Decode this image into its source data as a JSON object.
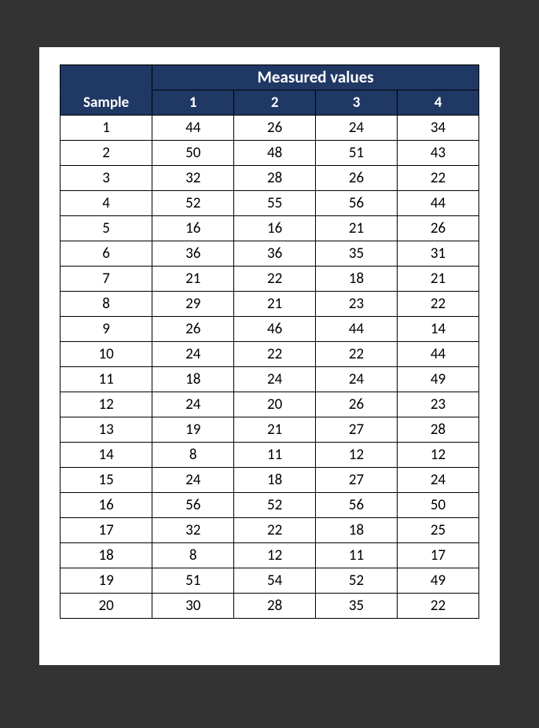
{
  "table": {
    "title": "Measured values",
    "sampleHeader": "Sample",
    "columns": [
      "1",
      "2",
      "3",
      "4"
    ],
    "rows": [
      {
        "sample": "1",
        "v": [
          "44",
          "26",
          "24",
          "34"
        ]
      },
      {
        "sample": "2",
        "v": [
          "50",
          "48",
          "51",
          "43"
        ]
      },
      {
        "sample": "3",
        "v": [
          "32",
          "28",
          "26",
          "22"
        ]
      },
      {
        "sample": "4",
        "v": [
          "52",
          "55",
          "56",
          "44"
        ]
      },
      {
        "sample": "5",
        "v": [
          "16",
          "16",
          "21",
          "26"
        ]
      },
      {
        "sample": "6",
        "v": [
          "36",
          "36",
          "35",
          "31"
        ]
      },
      {
        "sample": "7",
        "v": [
          "21",
          "22",
          "18",
          "21"
        ]
      },
      {
        "sample": "8",
        "v": [
          "29",
          "21",
          "23",
          "22"
        ]
      },
      {
        "sample": "9",
        "v": [
          "26",
          "46",
          "44",
          "14"
        ]
      },
      {
        "sample": "10",
        "v": [
          "24",
          "22",
          "22",
          "44"
        ]
      },
      {
        "sample": "11",
        "v": [
          "18",
          "24",
          "24",
          "49"
        ]
      },
      {
        "sample": "12",
        "v": [
          "24",
          "20",
          "26",
          "23"
        ]
      },
      {
        "sample": "13",
        "v": [
          "19",
          "21",
          "27",
          "28"
        ]
      },
      {
        "sample": "14",
        "v": [
          "8",
          "11",
          "12",
          "12"
        ]
      },
      {
        "sample": "15",
        "v": [
          "24",
          "18",
          "27",
          "24"
        ]
      },
      {
        "sample": "16",
        "v": [
          "56",
          "52",
          "56",
          "50"
        ]
      },
      {
        "sample": "17",
        "v": [
          "32",
          "22",
          "18",
          "25"
        ]
      },
      {
        "sample": "18",
        "v": [
          "8",
          "12",
          "11",
          "17"
        ]
      },
      {
        "sample": "19",
        "v": [
          "51",
          "54",
          "52",
          "49"
        ]
      },
      {
        "sample": "20",
        "v": [
          "30",
          "28",
          "35",
          "22"
        ]
      }
    ]
  },
  "chart_data": {
    "type": "table",
    "title": "Measured values",
    "columns": [
      "Sample",
      "1",
      "2",
      "3",
      "4"
    ],
    "rows": [
      [
        1,
        44,
        26,
        24,
        34
      ],
      [
        2,
        50,
        48,
        51,
        43
      ],
      [
        3,
        32,
        28,
        26,
        22
      ],
      [
        4,
        52,
        55,
        56,
        44
      ],
      [
        5,
        16,
        16,
        21,
        26
      ],
      [
        6,
        36,
        36,
        35,
        31
      ],
      [
        7,
        21,
        22,
        18,
        21
      ],
      [
        8,
        29,
        21,
        23,
        22
      ],
      [
        9,
        26,
        46,
        44,
        14
      ],
      [
        10,
        24,
        22,
        22,
        44
      ],
      [
        11,
        18,
        24,
        24,
        49
      ],
      [
        12,
        24,
        20,
        26,
        23
      ],
      [
        13,
        19,
        21,
        27,
        28
      ],
      [
        14,
        8,
        11,
        12,
        12
      ],
      [
        15,
        24,
        18,
        27,
        24
      ],
      [
        16,
        56,
        52,
        56,
        50
      ],
      [
        17,
        32,
        22,
        18,
        25
      ],
      [
        18,
        8,
        12,
        11,
        17
      ],
      [
        19,
        51,
        54,
        52,
        49
      ],
      [
        20,
        30,
        28,
        35,
        22
      ]
    ]
  }
}
